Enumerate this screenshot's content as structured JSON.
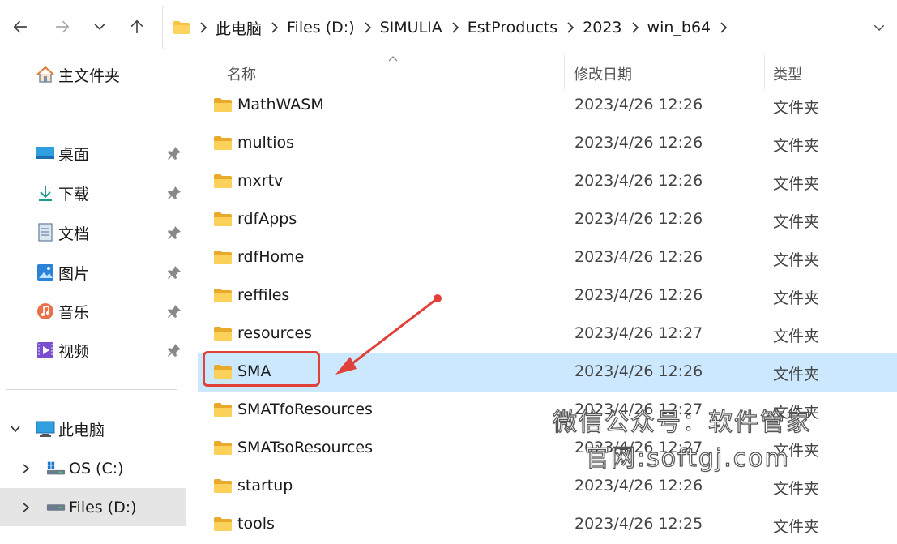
{
  "breadcrumb": {
    "items": [
      "此电脑",
      "Files (D:)",
      "SIMULIA",
      "EstProducts",
      "2023",
      "win_b64"
    ]
  },
  "sidebar": {
    "home": "主文件夹",
    "quick": [
      {
        "label": "桌面",
        "icon": "desktop-icon"
      },
      {
        "label": "下载",
        "icon": "download-icon"
      },
      {
        "label": "文档",
        "icon": "document-icon"
      },
      {
        "label": "图片",
        "icon": "pictures-icon"
      },
      {
        "label": "音乐",
        "icon": "music-icon"
      },
      {
        "label": "视频",
        "icon": "video-icon"
      }
    ],
    "this_pc": "此电脑",
    "drives": [
      {
        "label": "OS (C:)"
      },
      {
        "label": "Files (D:)"
      }
    ]
  },
  "columns": {
    "name": "名称",
    "date": "修改日期",
    "type": "类型"
  },
  "files": [
    {
      "name": "MathWASM",
      "date": "2023/4/26 12:26",
      "type": "文件夹"
    },
    {
      "name": "multios",
      "date": "2023/4/26 12:26",
      "type": "文件夹"
    },
    {
      "name": "mxrtv",
      "date": "2023/4/26 12:26",
      "type": "文件夹"
    },
    {
      "name": "rdfApps",
      "date": "2023/4/26 12:26",
      "type": "文件夹"
    },
    {
      "name": "rdfHome",
      "date": "2023/4/26 12:26",
      "type": "文件夹"
    },
    {
      "name": "reffiles",
      "date": "2023/4/26 12:26",
      "type": "文件夹"
    },
    {
      "name": "resources",
      "date": "2023/4/26 12:27",
      "type": "文件夹"
    },
    {
      "name": "SMA",
      "date": "2023/4/26 12:26",
      "type": "文件夹"
    },
    {
      "name": "SMATfoResources",
      "date": "2023/4/26 12:27",
      "type": "文件夹"
    },
    {
      "name": "SMATsoResources",
      "date": "2023/4/26 12:27",
      "type": "文件夹"
    },
    {
      "name": "startup",
      "date": "2023/4/26 12:26",
      "type": "文件夹"
    },
    {
      "name": "tools",
      "date": "2023/4/26 12:25",
      "type": "文件夹"
    }
  ],
  "selected_file": "SMA",
  "watermark": {
    "line1": "微信公众号：软件管家",
    "line2": "官网:softgj.com"
  },
  "colors": {
    "accent_select": "#cce8ff",
    "annotation_red": "#e0413a",
    "folder_yellow": "#f6c343"
  }
}
